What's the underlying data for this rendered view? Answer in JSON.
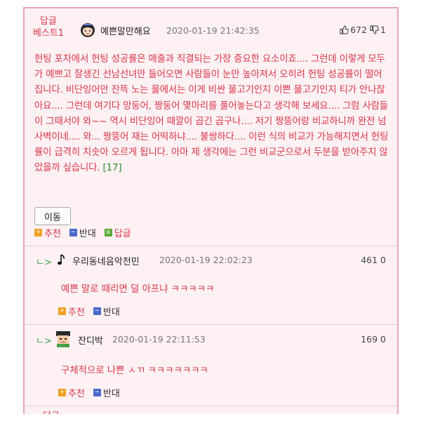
{
  "best_post": {
    "badge_line1": "답글",
    "badge_line2": "베스트1",
    "nickname": "예쁜말만해요",
    "date": "2020-01-19 21:42:35",
    "likes": "672",
    "dislikes": "1",
    "body": "헌팅 포차에서 헌팅 성공률은 매출과 직결되는 가장 중요한 요소이죠.... 그런데 이렇게 모두가 예쁘고 잘생긴 선남선녀만 들어오면 사람들이 눈만 높아져서 오히려 헌팅 성공률이 떨어집니다. 비단잉어만 잔뜩 노는 물에서는 이게 비싼 물고기인지 이쁜 물고기인지 티가 안나잖아요.... 그런데 여기다 망둥어, 짱둥어 몇마리를 풀어놓는다고 생각해 보세요.... 그럼 사람들이 그때서야 와~~ 역시 비단잉어 때깔이 곱긴 곱구나.... 저기 짱뚱어랑 비교하니까 완전 넘사벽이네.... 와... 짱뚱어 재는 어떡하냐.... 불쌍하다.... 이런 식의 비교가 가능해지면서 헌팅률이 급격히 치솟아 오르게 됩니다. 아마 제 생각에는 그런 비교군으로서 두분을 받아주지 않았을까 싶습니다.",
    "reply_count": "[17]",
    "move_button": "이동",
    "recommend": "추천",
    "oppose": "반대",
    "reply": "답글"
  },
  "replies": [
    {
      "arrow": "ㄴ>",
      "icon": "music-note-icon",
      "nickname": "우리동네음악천민",
      "date": "2020-01-19 22:02:23",
      "score": "461 0",
      "text": "예쁜 말로 때리면 덜 아프냐 ㅋㅋㅋㅋㅋ",
      "recommend": "추천",
      "oppose": "반대"
    },
    {
      "arrow": "ㄴ>",
      "icon": "pixel-avatar-icon",
      "nickname": "잔디박",
      "date": "2020-01-19 22:11:53",
      "score": "169 0",
      "text": "구체적으로 나쁜 ㅅㄲ ㅋㅋㅋㅋㅋㅋㅋ",
      "recommend": "추천",
      "oppose": "반대"
    }
  ],
  "next_badge": "답글",
  "colors": {
    "accent_red": "#d8364a",
    "border_pink": "#e8a5b4",
    "background_pink": "#fdf1f3"
  }
}
